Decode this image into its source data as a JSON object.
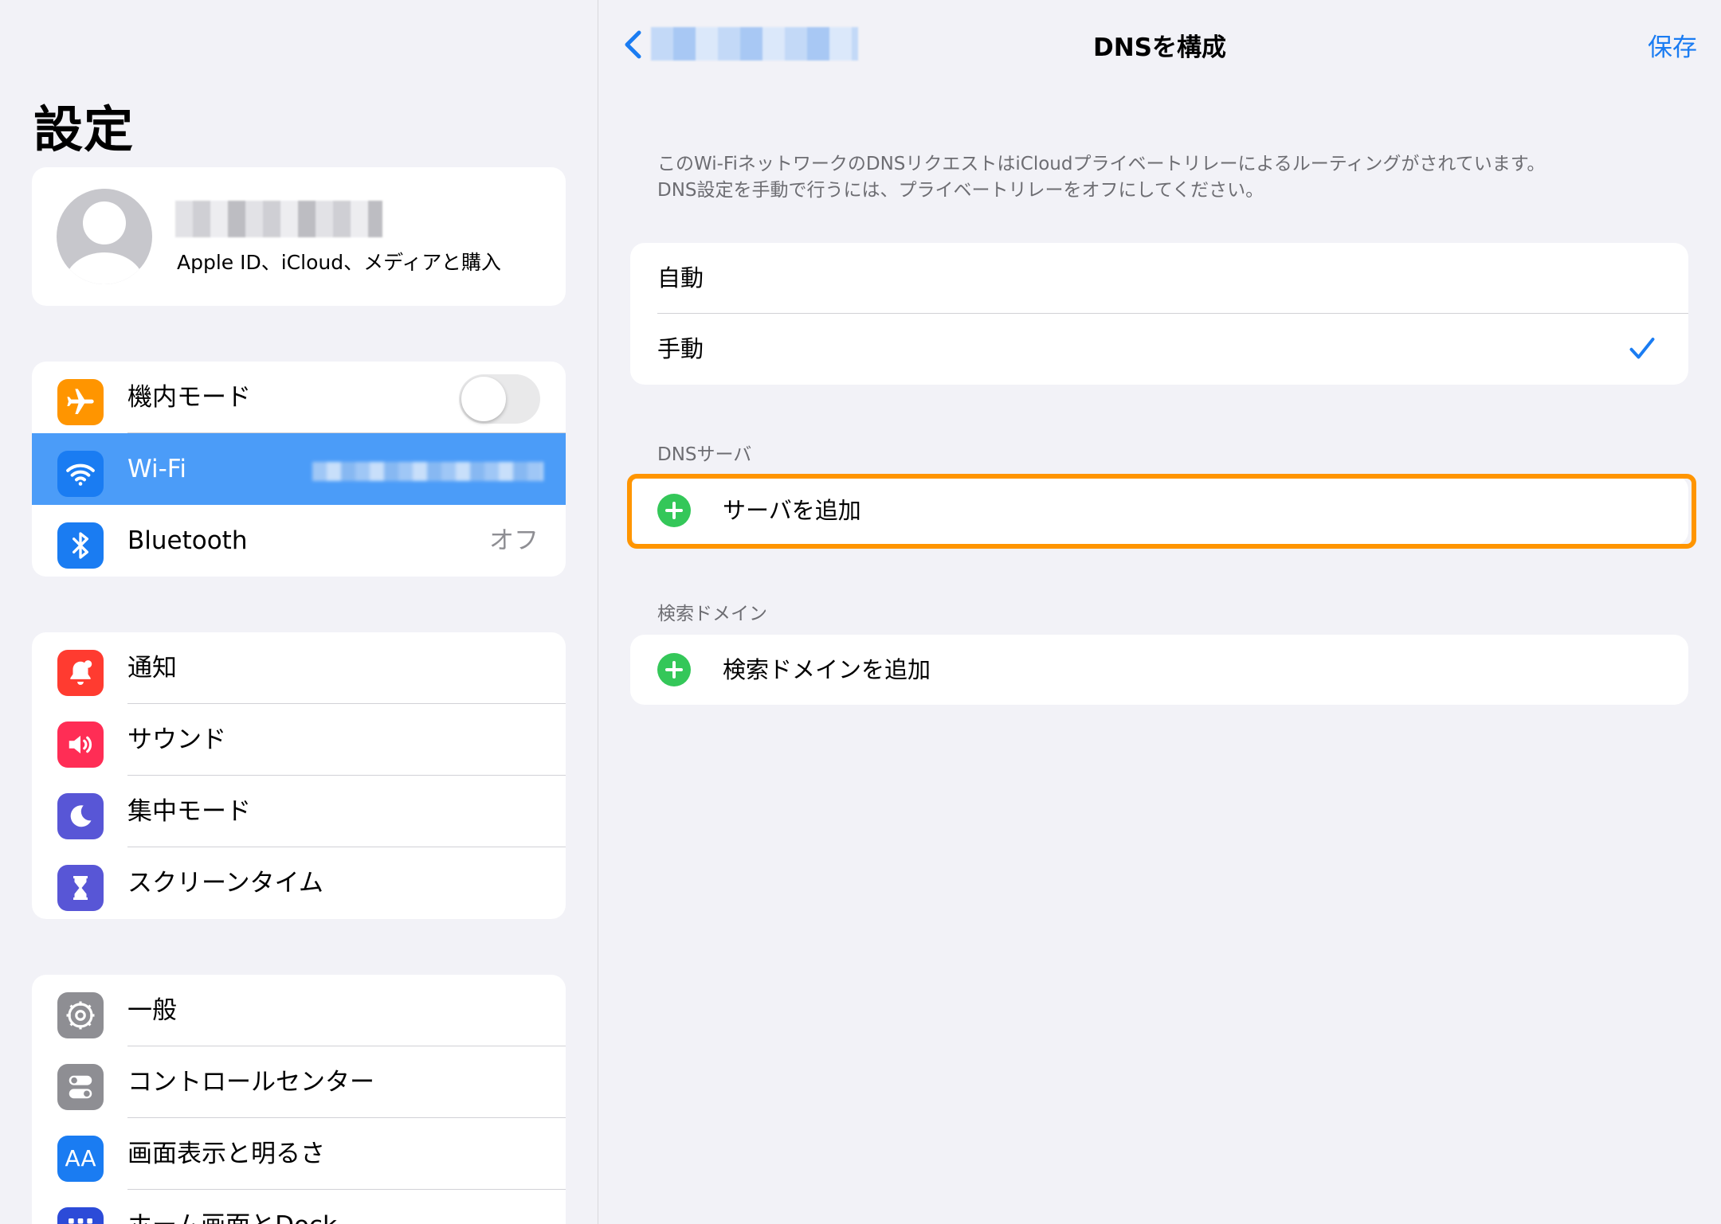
{
  "sidebar": {
    "title": "設定",
    "profile": {
      "subtitle": "Apple ID、iCloud、メディアと購入"
    },
    "group1": [
      {
        "label": "機内モード",
        "icon": "airplane-icon",
        "color": "#ff9500",
        "toggle": false
      },
      {
        "label": "Wi-Fi",
        "icon": "wifi-icon",
        "color": "#1a7cf2",
        "selected": true
      },
      {
        "label": "Bluetooth",
        "icon": "bluetooth-icon",
        "color": "#1a7cf2",
        "value": "オフ"
      }
    ],
    "group2": [
      {
        "label": "通知",
        "icon": "bell-icon",
        "color": "#ff3b30"
      },
      {
        "label": "サウンド",
        "icon": "speaker-icon",
        "color": "#ff2d55"
      },
      {
        "label": "集中モード",
        "icon": "moon-icon",
        "color": "#5856d6"
      },
      {
        "label": "スクリーンタイム",
        "icon": "hourglass-icon",
        "color": "#5856d6"
      }
    ],
    "group3": [
      {
        "label": "一般",
        "icon": "gear-icon",
        "color": "#8e8e93"
      },
      {
        "label": "コントロールセンター",
        "icon": "switches-icon",
        "color": "#8e8e93"
      },
      {
        "label": "画面表示と明るさ",
        "icon": "text-size-icon",
        "color": "#1a7cf2",
        "glyph": "AA"
      },
      {
        "label": "ホーム画面とDock",
        "icon": "home-grid-icon",
        "color": "#2c4bd8"
      }
    ]
  },
  "detail": {
    "nav": {
      "title": "DNSを構成",
      "save_label": "保存"
    },
    "info_lines": [
      "このWi-FiネットワークのDNSリクエストはiCloudプライベートリレーによるルーティングがされています。",
      "DNS設定を手動で行うには、プライベートリレーをオフにしてください。"
    ],
    "modes": [
      {
        "label": "自動",
        "checked": false
      },
      {
        "label": "手動",
        "checked": true
      }
    ],
    "dns_section": {
      "header": "DNSサーバ",
      "add_label": "サーバを追加"
    },
    "search_section": {
      "header": "検索ドメイン",
      "add_label": "検索ドメインを追加"
    },
    "accent_color": "#1a7cf2",
    "highlight_color": "#ff9500",
    "add_icon_color": "#34c759"
  }
}
